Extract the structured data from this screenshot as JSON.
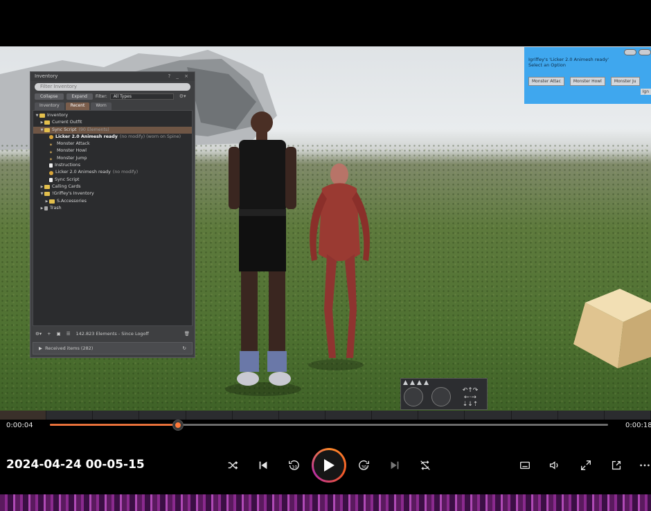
{
  "inventory": {
    "title": "Inventory",
    "controls": "? _ ×",
    "filter_placeholder": "Filter Inventory",
    "collapse_label": "Collapse",
    "expand_label": "Expand",
    "filter_label": "Filter:",
    "filter_value": "All Types",
    "tabs": [
      {
        "label": "Inventory"
      },
      {
        "label": "Recent"
      },
      {
        "label": "Worn"
      }
    ],
    "tree": [
      {
        "label": "Inventory",
        "arrow": "▼",
        "icon": "folder",
        "indent": 0
      },
      {
        "label": "Current Outfit",
        "arrow": "▶",
        "icon": "folder",
        "indent": 1
      },
      {
        "label": "Sync Script",
        "sub": "(90 Elements)",
        "arrow": "▼",
        "icon": "folder",
        "indent": 1,
        "selected": true
      },
      {
        "label": "Licker 2.0 Animesh ready",
        "sub": "(no modify) (worn on Spine)",
        "icon": "obj",
        "indent": 2,
        "bold": true
      },
      {
        "label": "Monster Attack",
        "icon": "anim",
        "indent": 2
      },
      {
        "label": "Monster Howl",
        "icon": "anim",
        "indent": 2
      },
      {
        "label": "Monster Jump",
        "icon": "anim",
        "indent": 2
      },
      {
        "label": "Instructions",
        "icon": "note",
        "indent": 2
      },
      {
        "label": "Licker 2.0 Animesh ready",
        "sub": "(no modify)",
        "icon": "obj",
        "indent": 2
      },
      {
        "label": "Sync Script",
        "icon": "note",
        "indent": 2
      },
      {
        "label": "Calling Cards",
        "arrow": "▶",
        "icon": "folder",
        "indent": 1
      },
      {
        "label": "!Griffey's Inventory",
        "arrow": "▼",
        "icon": "folder",
        "indent": 1
      },
      {
        "label": "S.Accessories",
        "arrow": "▶",
        "icon": "folder",
        "indent": 2
      },
      {
        "label": "Trash",
        "arrow": "▶",
        "icon": "trash",
        "indent": 1
      }
    ],
    "status": "142.823 Elements  - Since Logoff",
    "received": "Received items (282)"
  },
  "dialog": {
    "message_line1": "Igriffey's 'Licker 2.0 Animesh ready'",
    "message_line2": "Select an Option",
    "buttons": [
      "Monster Attac",
      "Monster Howl",
      "Monster Ju"
    ],
    "ignore_label": "Ign"
  },
  "player": {
    "current_time": "0:00:04",
    "total_time": "0:00:18",
    "progress": 0.23,
    "title": "2024-04-24 00-05-15",
    "skip_back_label": "10",
    "skip_forward_label": "30"
  },
  "colors": {
    "accent": "#ff7a3a",
    "dialog_bg": "#3fa7ee",
    "selected_row": "#6f5645"
  }
}
